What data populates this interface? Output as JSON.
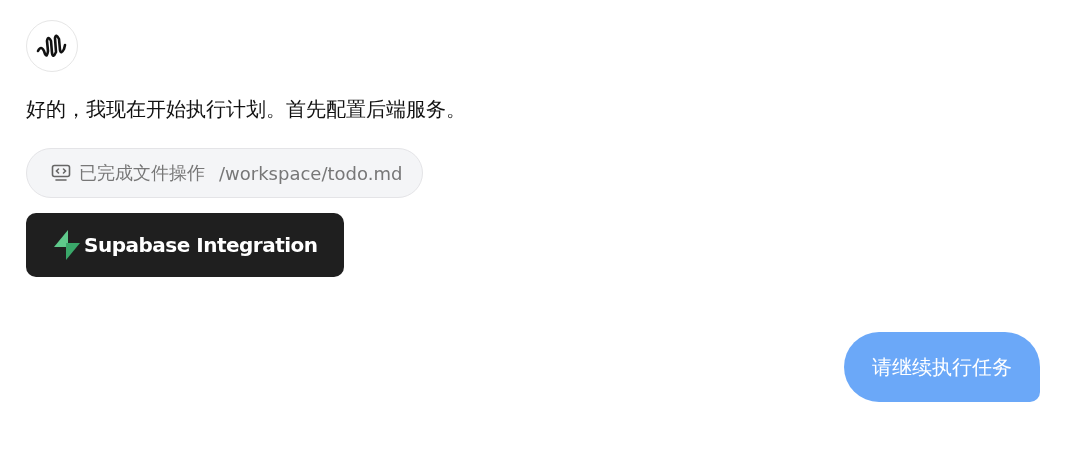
{
  "assistant": {
    "message": "好的，我现在开始执行计划。首先配置后端服务。",
    "file_operation": {
      "status": "已完成文件操作",
      "path": "/workspace/todo.md"
    },
    "integration": {
      "label": "Supabase Integration"
    }
  },
  "user_message": {
    "text": "请继续执行任务"
  }
}
